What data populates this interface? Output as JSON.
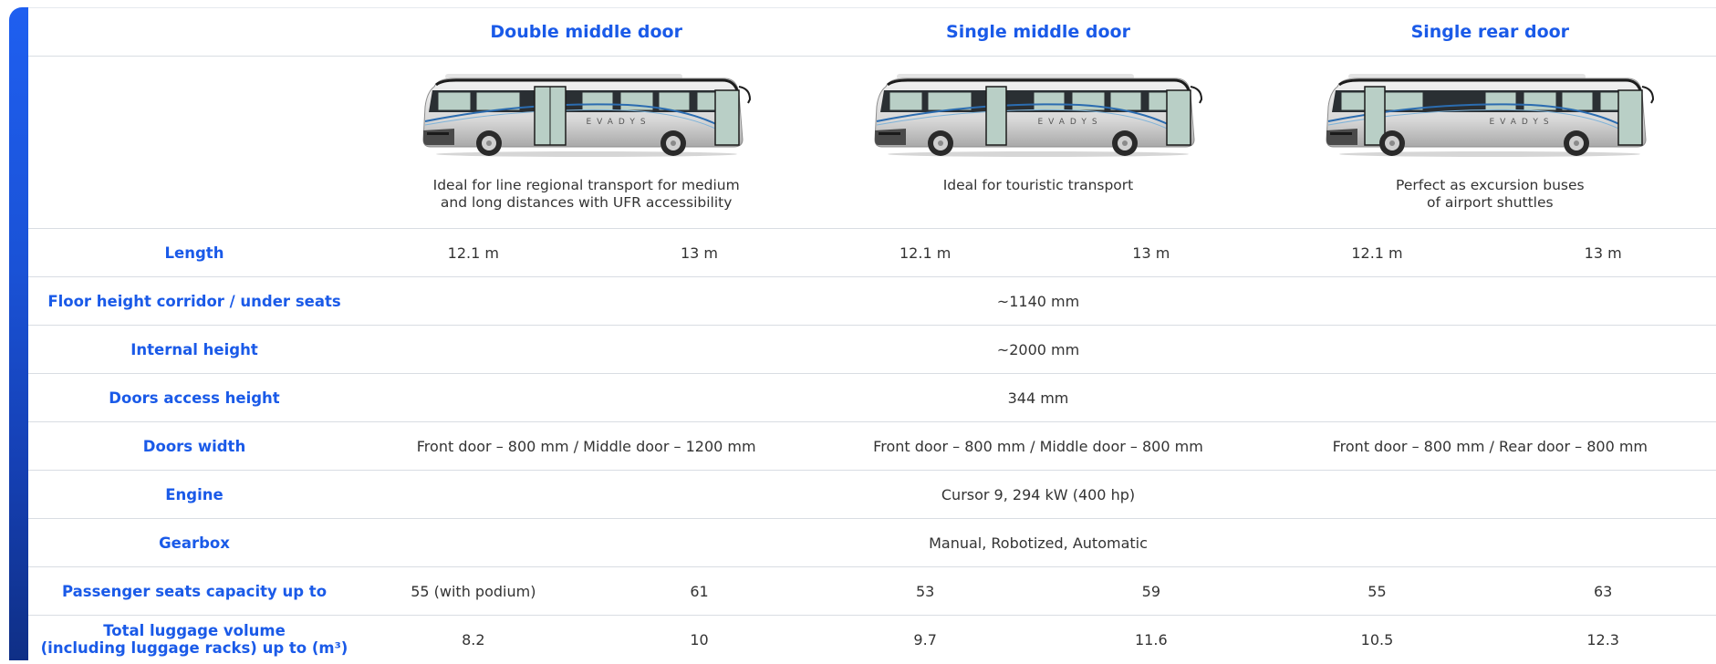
{
  "colors": {
    "accent": "#1a5ae8",
    "text": "#333333",
    "divider": "#d9dde3"
  },
  "variants": [
    {
      "title": "Double middle door",
      "description_line1": "Ideal for line regional transport for medium",
      "description_line2": "and long distances with UFR accessibility",
      "bus_logo": "EVADYS",
      "door_layout": "double-middle"
    },
    {
      "title": "Single middle door",
      "description_line1": "Ideal for touristic transport",
      "description_line2": "",
      "bus_logo": "EVADYS",
      "door_layout": "single-middle"
    },
    {
      "title": "Single rear door",
      "description_line1": "Perfect as excursion buses",
      "description_line2": "of airport shuttles",
      "bus_logo": "EVADYS",
      "door_layout": "single-rear"
    }
  ],
  "specs": {
    "length": {
      "label": "Length",
      "values": [
        "12.1 m",
        "13 m",
        "12.1 m",
        "13 m",
        "12.1 m",
        "13 m"
      ]
    },
    "floor_height": {
      "label": "Floor height corridor / under seats",
      "value": "~1140 mm"
    },
    "internal_height": {
      "label": "Internal height",
      "value": "~2000 mm"
    },
    "doors_access_height": {
      "label": "Doors access height",
      "value": "344 mm"
    },
    "doors_width": {
      "label": "Doors width",
      "values": [
        "Front door – 800 mm / Middle door – 1200 mm",
        "Front door – 800 mm / Middle door – 800 mm",
        "Front door – 800 mm / Rear door – 800 mm"
      ]
    },
    "engine": {
      "label": "Engine",
      "value": "Cursor 9, 294 kW (400 hp)"
    },
    "gearbox": {
      "label": "Gearbox",
      "value": "Manual, Robotized, Automatic"
    },
    "seats": {
      "label": "Passenger seats capacity up to",
      "values": [
        "55 (with podium)",
        "61",
        "53",
        "59",
        "55",
        "63"
      ]
    },
    "luggage": {
      "label_line1": "Total luggage volume",
      "label_line2": "(including luggage racks) up to (m³)",
      "values": [
        "8.2",
        "10",
        "9.7",
        "11.6",
        "10.5",
        "12.3"
      ]
    }
  }
}
